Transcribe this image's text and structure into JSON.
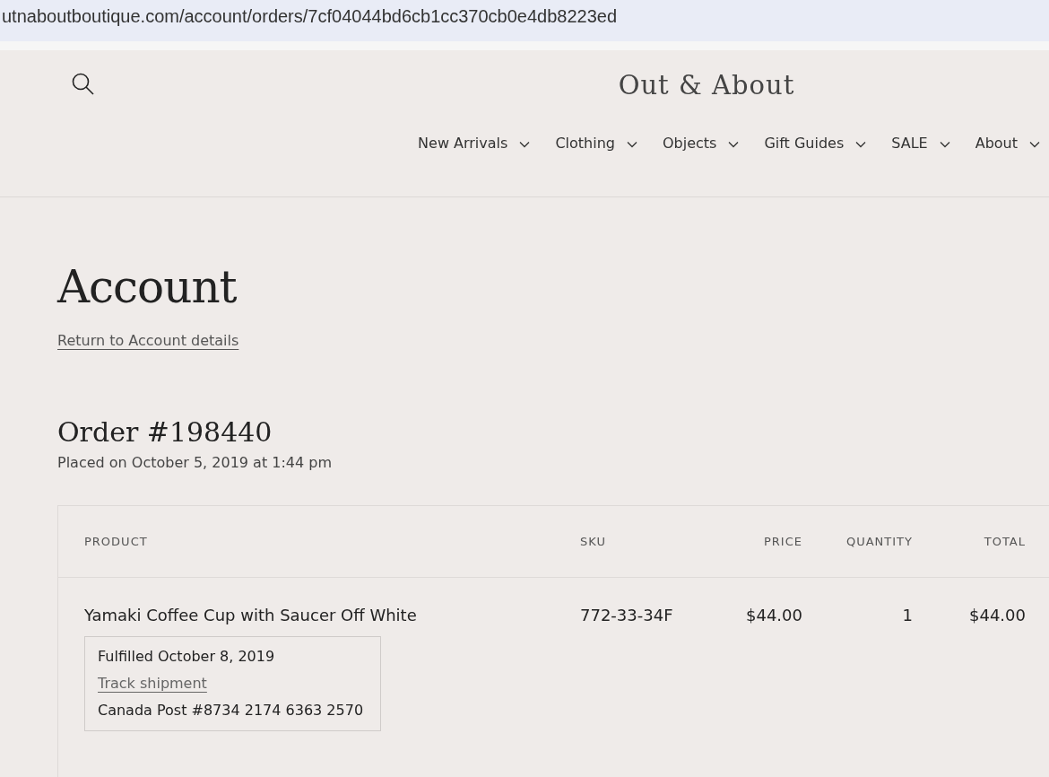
{
  "browser": {
    "url": "utnaboutboutique.com/account/orders/7cf04044bd6cb1cc370cb0e4db8223ed"
  },
  "header": {
    "logo": "Out & About",
    "nav": [
      "New Arrivals",
      "Clothing",
      "Objects",
      "Gift Guides",
      "SALE",
      "About"
    ]
  },
  "page": {
    "title": "Account",
    "back_link": "Return to Account details"
  },
  "order": {
    "title": "Order #198440",
    "placed": "Placed on October 5, 2019 at 1:44 pm"
  },
  "table": {
    "columns": [
      "PRODUCT",
      "SKU",
      "PRICE",
      "QUANTITY",
      "TOTAL"
    ],
    "rows": [
      {
        "product": "Yamaki Coffee Cup with Saucer Off White",
        "sku": "772-33-34F",
        "price": "$44.00",
        "quantity": "1",
        "total": "$44.00",
        "fulfillment": {
          "status": "Fulfilled October 8, 2019",
          "track_link": "Track shipment",
          "tracking": "Canada Post #8734 2174 6363 2570"
        }
      }
    ]
  }
}
